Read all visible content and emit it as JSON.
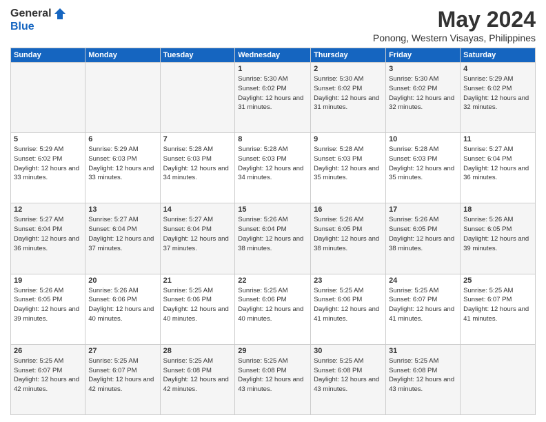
{
  "logo": {
    "general": "General",
    "blue": "Blue"
  },
  "title": "May 2024",
  "subtitle": "Ponong, Western Visayas, Philippines",
  "days_of_week": [
    "Sunday",
    "Monday",
    "Tuesday",
    "Wednesday",
    "Thursday",
    "Friday",
    "Saturday"
  ],
  "weeks": [
    [
      {
        "day": "",
        "info": ""
      },
      {
        "day": "",
        "info": ""
      },
      {
        "day": "",
        "info": ""
      },
      {
        "day": "1",
        "info": "Sunrise: 5:30 AM\nSunset: 6:02 PM\nDaylight: 12 hours and 31 minutes."
      },
      {
        "day": "2",
        "info": "Sunrise: 5:30 AM\nSunset: 6:02 PM\nDaylight: 12 hours and 31 minutes."
      },
      {
        "day": "3",
        "info": "Sunrise: 5:30 AM\nSunset: 6:02 PM\nDaylight: 12 hours and 32 minutes."
      },
      {
        "day": "4",
        "info": "Sunrise: 5:29 AM\nSunset: 6:02 PM\nDaylight: 12 hours and 32 minutes."
      }
    ],
    [
      {
        "day": "5",
        "info": "Sunrise: 5:29 AM\nSunset: 6:02 PM\nDaylight: 12 hours and 33 minutes."
      },
      {
        "day": "6",
        "info": "Sunrise: 5:29 AM\nSunset: 6:03 PM\nDaylight: 12 hours and 33 minutes."
      },
      {
        "day": "7",
        "info": "Sunrise: 5:28 AM\nSunset: 6:03 PM\nDaylight: 12 hours and 34 minutes."
      },
      {
        "day": "8",
        "info": "Sunrise: 5:28 AM\nSunset: 6:03 PM\nDaylight: 12 hours and 34 minutes."
      },
      {
        "day": "9",
        "info": "Sunrise: 5:28 AM\nSunset: 6:03 PM\nDaylight: 12 hours and 35 minutes."
      },
      {
        "day": "10",
        "info": "Sunrise: 5:28 AM\nSunset: 6:03 PM\nDaylight: 12 hours and 35 minutes."
      },
      {
        "day": "11",
        "info": "Sunrise: 5:27 AM\nSunset: 6:04 PM\nDaylight: 12 hours and 36 minutes."
      }
    ],
    [
      {
        "day": "12",
        "info": "Sunrise: 5:27 AM\nSunset: 6:04 PM\nDaylight: 12 hours and 36 minutes."
      },
      {
        "day": "13",
        "info": "Sunrise: 5:27 AM\nSunset: 6:04 PM\nDaylight: 12 hours and 37 minutes."
      },
      {
        "day": "14",
        "info": "Sunrise: 5:27 AM\nSunset: 6:04 PM\nDaylight: 12 hours and 37 minutes."
      },
      {
        "day": "15",
        "info": "Sunrise: 5:26 AM\nSunset: 6:04 PM\nDaylight: 12 hours and 38 minutes."
      },
      {
        "day": "16",
        "info": "Sunrise: 5:26 AM\nSunset: 6:05 PM\nDaylight: 12 hours and 38 minutes."
      },
      {
        "day": "17",
        "info": "Sunrise: 5:26 AM\nSunset: 6:05 PM\nDaylight: 12 hours and 38 minutes."
      },
      {
        "day": "18",
        "info": "Sunrise: 5:26 AM\nSunset: 6:05 PM\nDaylight: 12 hours and 39 minutes."
      }
    ],
    [
      {
        "day": "19",
        "info": "Sunrise: 5:26 AM\nSunset: 6:05 PM\nDaylight: 12 hours and 39 minutes."
      },
      {
        "day": "20",
        "info": "Sunrise: 5:26 AM\nSunset: 6:06 PM\nDaylight: 12 hours and 40 minutes."
      },
      {
        "day": "21",
        "info": "Sunrise: 5:25 AM\nSunset: 6:06 PM\nDaylight: 12 hours and 40 minutes."
      },
      {
        "day": "22",
        "info": "Sunrise: 5:25 AM\nSunset: 6:06 PM\nDaylight: 12 hours and 40 minutes."
      },
      {
        "day": "23",
        "info": "Sunrise: 5:25 AM\nSunset: 6:06 PM\nDaylight: 12 hours and 41 minutes."
      },
      {
        "day": "24",
        "info": "Sunrise: 5:25 AM\nSunset: 6:07 PM\nDaylight: 12 hours and 41 minutes."
      },
      {
        "day": "25",
        "info": "Sunrise: 5:25 AM\nSunset: 6:07 PM\nDaylight: 12 hours and 41 minutes."
      }
    ],
    [
      {
        "day": "26",
        "info": "Sunrise: 5:25 AM\nSunset: 6:07 PM\nDaylight: 12 hours and 42 minutes."
      },
      {
        "day": "27",
        "info": "Sunrise: 5:25 AM\nSunset: 6:07 PM\nDaylight: 12 hours and 42 minutes."
      },
      {
        "day": "28",
        "info": "Sunrise: 5:25 AM\nSunset: 6:08 PM\nDaylight: 12 hours and 42 minutes."
      },
      {
        "day": "29",
        "info": "Sunrise: 5:25 AM\nSunset: 6:08 PM\nDaylight: 12 hours and 43 minutes."
      },
      {
        "day": "30",
        "info": "Sunrise: 5:25 AM\nSunset: 6:08 PM\nDaylight: 12 hours and 43 minutes."
      },
      {
        "day": "31",
        "info": "Sunrise: 5:25 AM\nSunset: 6:08 PM\nDaylight: 12 hours and 43 minutes."
      },
      {
        "day": "",
        "info": ""
      }
    ]
  ]
}
